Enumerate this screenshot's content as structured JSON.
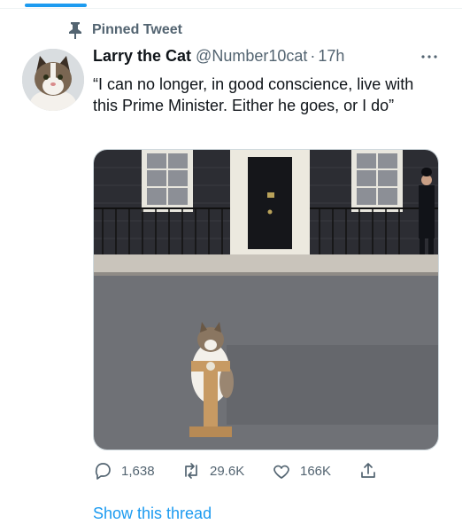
{
  "pinned": {
    "label": "Pinned Tweet",
    "icon": "pin-icon"
  },
  "author": {
    "name": "Larry the Cat",
    "handle": "@Number10cat",
    "separator": "·",
    "time": "17h"
  },
  "tweet": {
    "text": "“I can no longer, in good conscience, live with this Prime Minister. Either he goes, or I do”"
  },
  "media": {
    "description_icon": "photo"
  },
  "actions": {
    "reply": {
      "icon": "reply-icon",
      "count": "1,638"
    },
    "retweet": {
      "icon": "retweet-icon",
      "count": "29.6K"
    },
    "like": {
      "icon": "heart-icon",
      "count": "166K"
    },
    "share": {
      "icon": "share-icon"
    }
  },
  "thread_link": "Show this thread",
  "colors": {
    "accent": "#1d9bf0",
    "secondary_text": "#536471",
    "text": "#0f1419"
  }
}
